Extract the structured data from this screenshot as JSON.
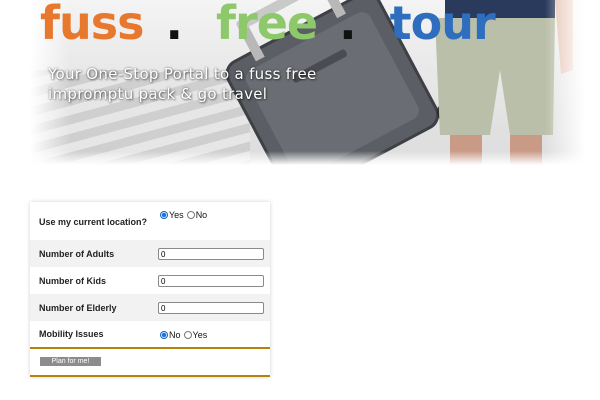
{
  "banner": {
    "logo": {
      "word1": "fuss",
      "word2": "free",
      "word3": "tour",
      "separator": ".",
      "colors": {
        "word1": "#e8782e",
        "word2": "#8dc96a",
        "word3": "#2f6dbf"
      }
    },
    "tagline_line1": "Your One-Stop Portal to a fuss free",
    "tagline_line2": "impromptu pack & go travel"
  },
  "form": {
    "location": {
      "label": "Use my current location?",
      "options": [
        {
          "label": "Yes",
          "selected": true
        },
        {
          "label": "No",
          "selected": false
        }
      ]
    },
    "adults": {
      "label": "Number of Adults",
      "value": "0"
    },
    "kids": {
      "label": "Number of Kids",
      "value": "0"
    },
    "elderly": {
      "label": "Number of Elderly",
      "value": "0"
    },
    "mobility": {
      "label": "Mobility Issues",
      "options": [
        {
          "label": "No",
          "selected": true
        },
        {
          "label": "Yes",
          "selected": false
        }
      ]
    },
    "submit_label": "Plan for me!",
    "accent_color": "#b5830b"
  }
}
